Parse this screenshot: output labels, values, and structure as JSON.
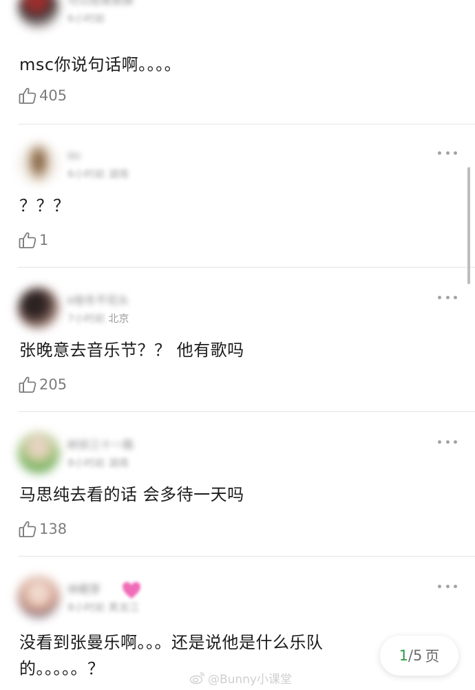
{
  "comments": [
    {
      "username": "可以轻易卖掉",
      "time": "6小时前",
      "location": "",
      "text": "msc你说句话啊。。。。",
      "likes": "405"
    },
    {
      "username": "lin",
      "time": "6小时前 湖南",
      "location": "",
      "text": "？？？",
      "likes": "1"
    },
    {
      "username": "k桂冬不花头",
      "time": "7小时前",
      "location": "北京",
      "text": "张晚意去音乐节？？ 他有歌吗",
      "likes": "205"
    },
    {
      "username": "树状三十一路",
      "time": "8小时前 湖南",
      "location": "",
      "text": "马思纯去看的话 会多待一天吗",
      "likes": "138"
    },
    {
      "username": "休眠芽",
      "time": "8小时前 黑龙江",
      "location": "",
      "text": "没看到张曼乐啊。。。还是说他是什么乐队的。。。。。？",
      "likes": ""
    }
  ],
  "pager": {
    "current": "1",
    "total": "/5",
    "suffix": "页"
  },
  "watermark": {
    "text": "@Bunny小课堂"
  },
  "icons": {
    "more": "more-dots-icon",
    "like": "thumb-up-icon",
    "watermark": "weibo-logo-icon"
  },
  "colors": {
    "text": "#1b1b1b",
    "secondary": "#7c7c7c",
    "pager_current": "#2b9a3f",
    "divider": "#e4e4e4"
  }
}
